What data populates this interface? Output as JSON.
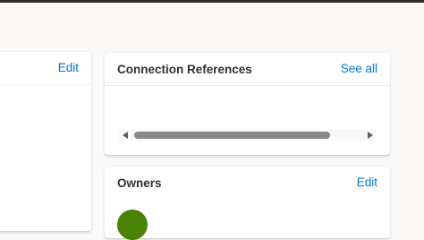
{
  "left_card": {
    "edit_label": "Edit"
  },
  "connection_references": {
    "title": "Connection References",
    "see_all_label": "See all"
  },
  "owners": {
    "title": "Owners",
    "edit_label": "Edit",
    "avatar_color": "#498205"
  }
}
